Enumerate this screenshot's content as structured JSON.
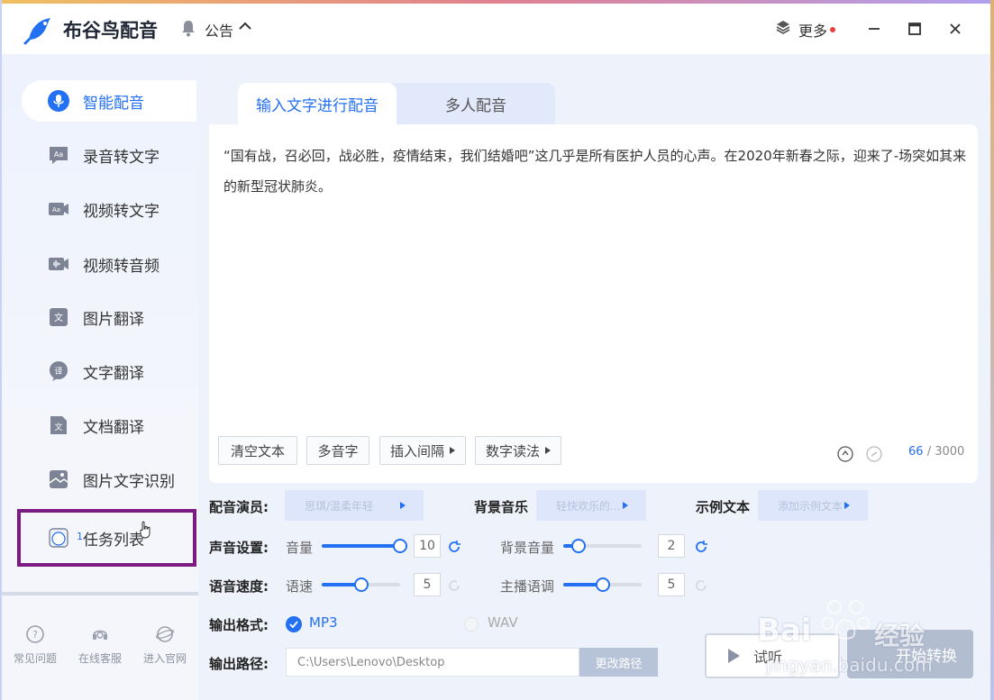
{
  "app": {
    "title": "布谷鸟配音",
    "notice": "公告",
    "more": "更多"
  },
  "sidebar": {
    "items": [
      {
        "label": "智能配音"
      },
      {
        "label": "录音转文字"
      },
      {
        "label": "视频转文字"
      },
      {
        "label": "视频转音频"
      },
      {
        "label": "图片翻译"
      },
      {
        "label": "文字翻译"
      },
      {
        "label": "文档翻译"
      },
      {
        "label": "图片文字识别"
      },
      {
        "label": "任务列表",
        "badge": "1"
      }
    ],
    "bottom": [
      {
        "label": "常见问题"
      },
      {
        "label": "在线客服"
      },
      {
        "label": "进入官网"
      }
    ]
  },
  "tabs": [
    {
      "label": "输入文字进行配音"
    },
    {
      "label": "多人配音"
    }
  ],
  "editor": {
    "text": "“国有战，召必回，战必胜，疫情结束，我们结婚吧”这几乎是所有医护人员的心声。在2020年新春之际，迎来了-场突如其来的新型冠状肺炎。",
    "toolbar": {
      "clear": "清空文本",
      "polyphone": "多音字",
      "insert_pause": "插入间隔",
      "number_reading": "数字读法"
    },
    "count": "66",
    "max": "/ 3000"
  },
  "settings": {
    "voice_actor_label": "配音演员:",
    "voice_actor_value": "思琪/温柔年轻",
    "bgm_label": "背景音乐",
    "bgm_value": "轻快欢乐的...",
    "sample_label": "示例文本",
    "sample_value": "添加示例文本",
    "sound_label": "声音设置:",
    "volume_label": "音量",
    "volume_value": "10",
    "volume_level": 1.0,
    "bg_volume_label": "背景音量",
    "bg_volume_value": "2",
    "bg_volume_level": 0.2,
    "speed_label": "语音速度:",
    "rate_label": "语速",
    "rate_value": "5",
    "rate_level": 0.5,
    "pitch_label": "主播语调",
    "pitch_value": "5",
    "pitch_level": 0.5,
    "format_label": "输出格式:",
    "format_mp3": "MP3",
    "format_wav": "WAV",
    "path_label": "输出路径:",
    "path_value": "C:\\Users\\Lenovo\\Desktop",
    "change_path": "更改路径",
    "preview": "试听",
    "start": "开始转换"
  },
  "watermark": {
    "brand": "Bai",
    "brand2": "经验",
    "url": "jingyan.baidu.com"
  },
  "colors": {
    "accent": "#2370f2",
    "highlight_box": "#7a1a82",
    "notification_dot": "#f23c3c"
  }
}
